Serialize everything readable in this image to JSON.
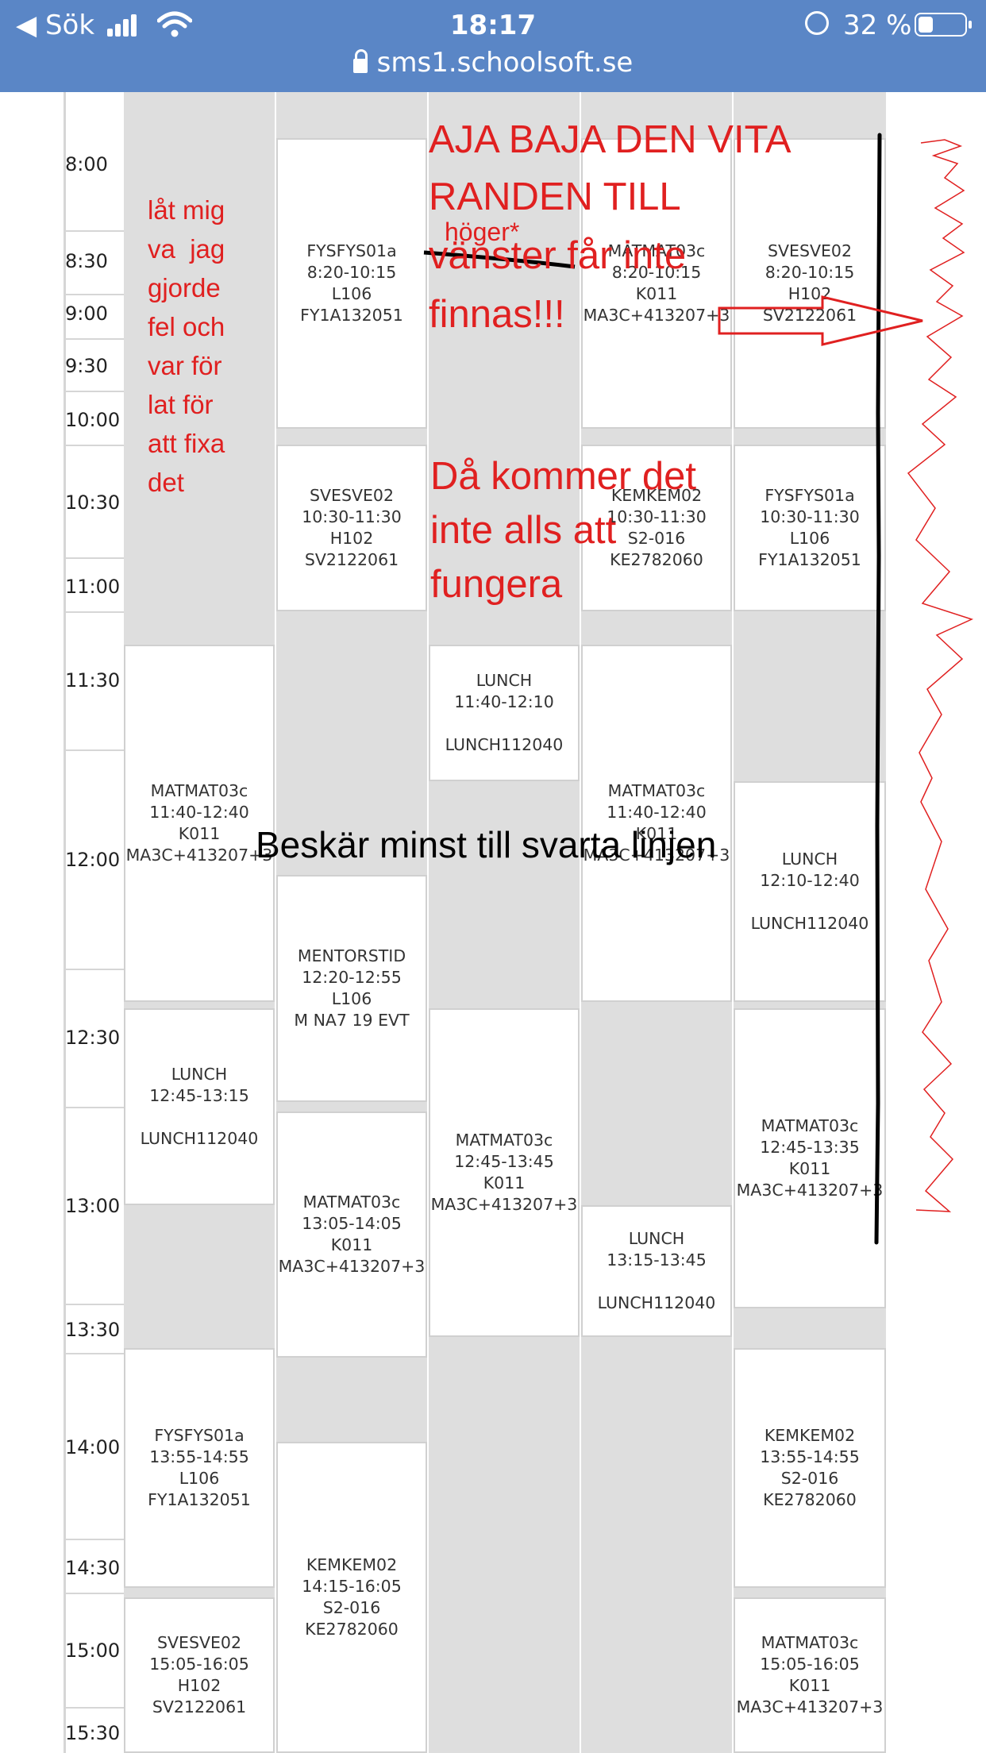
{
  "status_bar": {
    "back_label": "◀ Sök",
    "time": "18:17",
    "battery_percent": "32 %",
    "url": "sms1.schoolsoft.se"
  },
  "time_labels": [
    "8:00",
    "8:30",
    "9:00",
    "9:30",
    "10:00",
    "10:30",
    "11:00",
    "11:30",
    "12:00",
    "12:30",
    "13:00",
    "13:30",
    "14:00",
    "14:30",
    "15:00",
    "15:30"
  ],
  "lessons": [
    {
      "lines": [
        "FYSFYS01a",
        "8:20-10:15",
        "L106",
        "FY1A132051"
      ]
    },
    {
      "lines": [
        "MATMAT03c",
        "8:20-10:15",
        "K011",
        "MA3C+413207+3"
      ]
    },
    {
      "lines": [
        "SVESVE02",
        "8:20-10:15",
        "H102",
        "SV2122061"
      ]
    },
    {
      "lines": [
        "SVESVE02",
        "10:30-11:30",
        "H102",
        "SV2122061"
      ]
    },
    {
      "lines": [
        "KEMKEM02",
        "10:30-11:30",
        "S2-016",
        "KE2782060"
      ]
    },
    {
      "lines": [
        "FYSFYS01a",
        "10:30-11:30",
        "L106",
        "FY1A132051"
      ]
    },
    {
      "lines": [
        "LUNCH",
        "11:40-12:10",
        "",
        "LUNCH112040"
      ]
    },
    {
      "lines": [
        "MATMAT03c",
        "11:40-12:40",
        "K011",
        "MA3C+413207+3"
      ]
    },
    {
      "lines": [
        "MATMAT03c",
        "11:40-12:40",
        "K011",
        "MA3C+413207+3"
      ]
    },
    {
      "lines": [
        "LUNCH",
        "12:10-12:40",
        "",
        "LUNCH112040"
      ]
    },
    {
      "lines": [
        "MENTORSTID",
        "12:20-12:55",
        "L106",
        "M NA7 19 EVT"
      ]
    },
    {
      "lines": [
        "LUNCH",
        "12:45-13:15",
        "",
        "LUNCH112040"
      ]
    },
    {
      "lines": [
        "MATMAT03c",
        "12:45-13:45",
        "K011",
        "MA3C+413207+3"
      ]
    },
    {
      "lines": [
        "MATMAT03c",
        "12:45-13:35",
        "K011",
        "MA3C+413207+3"
      ]
    },
    {
      "lines": [
        "MATMAT03c",
        "13:05-14:05",
        "K011",
        "MA3C+413207+3"
      ]
    },
    {
      "lines": [
        "LUNCH",
        "13:15-13:45",
        "",
        "LUNCH112040"
      ]
    },
    {
      "lines": [
        "FYSFYS01a",
        "13:55-14:55",
        "L106",
        "FY1A132051"
      ]
    },
    {
      "lines": [
        "KEMKEM02",
        "13:55-14:55",
        "S2-016",
        "KE2782060"
      ]
    },
    {
      "lines": [
        "KEMKEM02",
        "14:15-16:05",
        "S2-016",
        "KE2782060"
      ]
    },
    {
      "lines": [
        "SVESVE02",
        "15:05-16:05",
        "H102",
        "SV2122061"
      ]
    },
    {
      "lines": [
        "MATMAT03c",
        "15:05-16:05",
        "K011",
        "MA3C+413207+3"
      ]
    }
  ],
  "annotations": {
    "left_note": "låt mig\nva  jag\ngjorde\nfel och\nvar för\nlat för\natt fixa\ndet",
    "headline": "AJA BAJA DEN VITA\nRANDEN TILL",
    "correction": "höger*",
    "struck_word": "vänster",
    "headline_tail": " får inte",
    "headline_end": "finnas!!!",
    "warning": "Då kommer det\ninte alls att\nfungera",
    "crop_note": "Beskär minst till svarta linjen",
    "color_red": "#e02020",
    "color_black": "#000000"
  },
  "colors": {
    "status_bar": "#5a86c6",
    "grid_background": "#dedede",
    "lesson_background": "#ffffff",
    "lesson_text": "#333333"
  }
}
